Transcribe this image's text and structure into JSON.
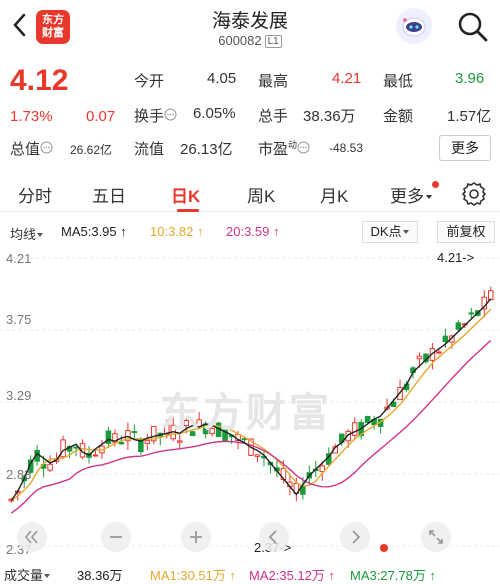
{
  "header": {
    "title": "海泰发展",
    "code": "600082",
    "level": "L1",
    "logo_line1": "东方",
    "logo_line2": "财富"
  },
  "quote": {
    "price": "4.12",
    "change_pct": "1.73%",
    "change": "0.07",
    "open_label": "今开",
    "open": "4.05",
    "high_label": "最高",
    "high": "4.21",
    "low_label": "最低",
    "low": "3.96",
    "turnover_label": "换手",
    "turnover": "6.05%",
    "volume_label": "总手",
    "volume": "38.36万",
    "amount_label": "金额",
    "amount": "1.57亿",
    "mktcap_label": "总值",
    "mktcap": "26.62亿",
    "float_label": "流值",
    "float": "26.13亿",
    "pe_label": "市盈",
    "pe_sup": "动",
    "pe": "-48.53",
    "more_label": "更多"
  },
  "tabs": [
    {
      "label": "分时"
    },
    {
      "label": "五日"
    },
    {
      "label": "日K"
    },
    {
      "label": "周K"
    },
    {
      "label": "月K"
    },
    {
      "label": "更多"
    }
  ],
  "ma": {
    "type_label": "均线",
    "ma5": "MA5:3.95 ↑",
    "ma10": "10:3.82 ↑",
    "ma20": "20:3.59 ↑",
    "dk_label": "DK点",
    "adjust_label": "前复权"
  },
  "chart": {
    "y_top": "4.21",
    "y_2": "3.75",
    "y_3": "3.29",
    "y_4": "2.83",
    "y_bottom": "2.37",
    "max_marker": "4.21->",
    "min_marker": "2.37->",
    "watermark": "东方财富"
  },
  "volume": {
    "label": "成交量",
    "value": "38.36万",
    "ma1": "MA1:30.51万 ↑",
    "ma2": "MA2:35.12万 ↑",
    "ma3": "MA3:27.78万 ↑"
  },
  "colors": {
    "up": "#e8382c",
    "down": "#1a9b3c",
    "ma5": "#222222",
    "ma10": "#e3a92e",
    "ma20": "#d0348a"
  },
  "chart_data": {
    "type": "candlestick",
    "ylim": [
      2.37,
      4.21
    ],
    "y_ticks": [
      "4.21",
      "3.75",
      "3.29",
      "2.83",
      "2.37"
    ],
    "max": 4.21,
    "min": 2.37,
    "ma5_close": [
      2.66,
      2.72,
      2.8,
      2.9,
      2.96,
      2.93,
      2.9,
      2.92,
      2.98,
      3.0,
      3.02,
      2.97,
      2.95,
      2.99,
      3.02,
      3.05,
      3.04,
      3.06,
      3.07,
      3.05,
      3.04,
      3.06,
      3.07,
      3.08,
      3.09,
      3.1,
      3.09,
      3.12,
      3.14,
      3.13,
      3.15,
      3.14,
      3.12,
      3.1,
      3.08,
      3.05,
      3.03,
      3.0,
      2.98,
      2.95,
      2.9,
      2.85,
      2.8,
      2.75,
      2.7,
      2.76,
      2.82,
      2.86,
      2.9,
      2.94,
      3.0,
      3.03,
      3.08,
      3.1,
      3.12,
      3.15,
      3.18,
      3.2,
      3.25,
      3.3,
      3.35,
      3.4,
      3.48,
      3.52,
      3.56,
      3.6,
      3.63,
      3.66,
      3.7,
      3.74,
      3.78,
      3.82,
      3.86,
      3.9,
      3.95
    ]
  }
}
